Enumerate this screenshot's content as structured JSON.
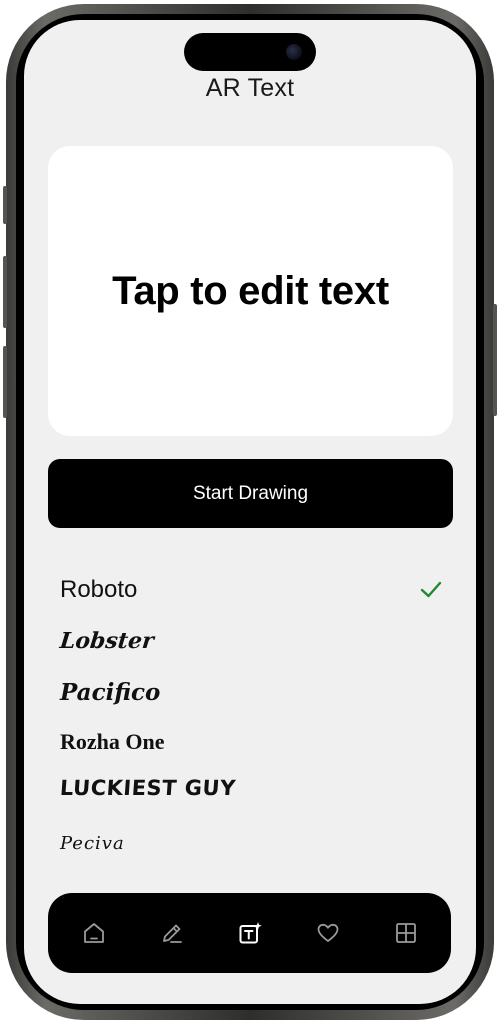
{
  "app": {
    "title": "AR Text"
  },
  "editor": {
    "placeholder_text": "Tap to edit text"
  },
  "actions": {
    "start_drawing_label": "Start Drawing"
  },
  "fonts": [
    {
      "name": "Roboto",
      "selected": true
    },
    {
      "name": "Lobster",
      "selected": false
    },
    {
      "name": "Pacifico",
      "selected": false
    },
    {
      "name": "Rozha One",
      "selected": false
    },
    {
      "name": "LUCKIEST GUY",
      "selected": false
    },
    {
      "name": "Peciva",
      "selected": false
    }
  ],
  "tabbar": {
    "tabs": [
      {
        "icon": "home-icon",
        "active": false
      },
      {
        "icon": "pencil-icon",
        "active": false
      },
      {
        "icon": "text-sparkle-icon",
        "active": true
      },
      {
        "icon": "heart-icon",
        "active": false
      },
      {
        "icon": "grid-icon",
        "active": false
      }
    ]
  },
  "colors": {
    "background": "#f0f0f0",
    "card": "#ffffff",
    "primary": "#000000",
    "check": "#1e8a2e",
    "tab_inactive": "#9a9a9a",
    "tab_active": "#ffffff"
  }
}
